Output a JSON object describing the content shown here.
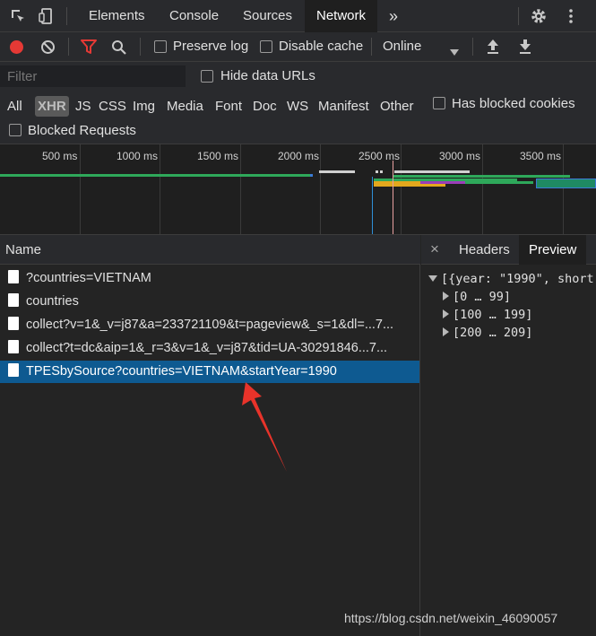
{
  "tabs": [
    {
      "label": "Elements"
    },
    {
      "label": "Console"
    },
    {
      "label": "Sources"
    },
    {
      "label": "Network"
    }
  ],
  "tabs_overflow": "»",
  "toolbar": {
    "preserve_log": "Preserve log",
    "disable_cache": "Disable cache",
    "throttle": "Online"
  },
  "filter": {
    "placeholder": "Filter",
    "hide_data_urls": "Hide data URLs",
    "types": [
      "All",
      "XHR",
      "JS",
      "CSS",
      "Img",
      "Media",
      "Font",
      "Doc",
      "WS",
      "Manifest",
      "Other"
    ],
    "active_type": "XHR",
    "has_blocked_cookies": "Has blocked cookies",
    "blocked_requests": "Blocked Requests"
  },
  "overview": {
    "ticks": [
      "500 ms",
      "1000 ms",
      "1500 ms",
      "2000 ms",
      "2500 ms",
      "3000 ms",
      "3500 ms"
    ]
  },
  "requests": {
    "header": "Name",
    "rows": [
      {
        "name": "?countries=VIETNAM"
      },
      {
        "name": "countries"
      },
      {
        "name": "collect?v=1&_v=j87&a=233721109&t=pageview&_s=1&dl=...7..."
      },
      {
        "name": "collect?t=dc&aip=1&_r=3&v=1&_v=j87&tid=UA-30291846...7..."
      },
      {
        "name": "TPESbySource?countries=VIETNAM&startYear=1990"
      }
    ],
    "selected_index": 4
  },
  "detail": {
    "close": "×",
    "tabs": [
      {
        "label": "Headers"
      },
      {
        "label": "Preview"
      }
    ],
    "active_tab": "Preview",
    "preview_root": "[{year: \"1990\", short",
    "preview_groups": [
      "[0 … 99]",
      "[100 … 199]",
      "[200 … 209]"
    ]
  },
  "watermark": "https://blog.csdn.net/weixin_46090057",
  "colors": {
    "record": "#e53935",
    "filter_active": "#e53935",
    "selected_row": "#0e5a91",
    "arrow": "#e8332a"
  }
}
